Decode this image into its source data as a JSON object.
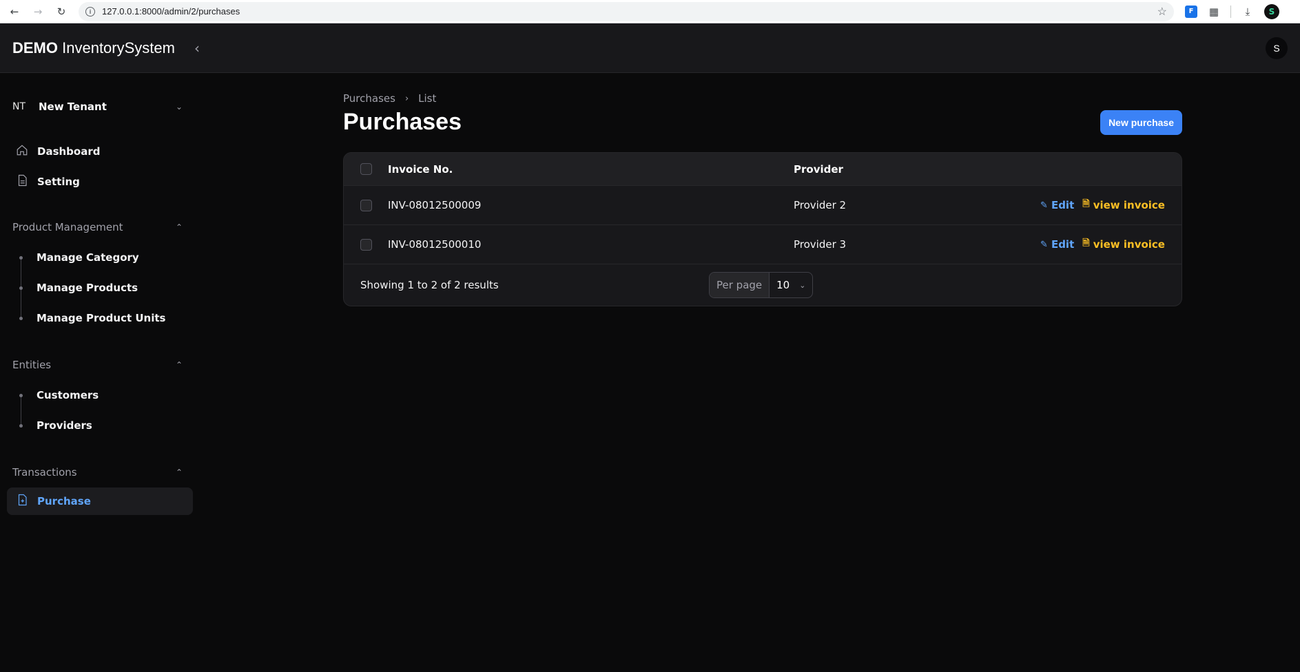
{
  "browser": {
    "url": "127.0.0.1:8000/admin/2/purchases",
    "ext_label": "F",
    "profile_initial": "S"
  },
  "topbar": {
    "brand_bold": "DEMO",
    "brand_rest": "InventorySystem",
    "avatar_initial": "S"
  },
  "tenant": {
    "initials": "NT",
    "name": "New Tenant"
  },
  "sidebar": {
    "top_items": [
      {
        "label": "Dashboard",
        "icon": "home-icon"
      },
      {
        "label": "Setting",
        "icon": "document-icon"
      }
    ],
    "groups": [
      {
        "title": "Product Management",
        "items": [
          "Manage Category",
          "Manage Products",
          "Manage Product Units"
        ]
      },
      {
        "title": "Entities",
        "items": [
          "Customers",
          "Providers"
        ]
      },
      {
        "title": "Transactions",
        "active_item": {
          "label": "Purchase",
          "icon": "document-plus-icon"
        }
      }
    ]
  },
  "breadcrumb": {
    "first": "Purchases",
    "second": "List"
  },
  "page": {
    "title": "Purchases",
    "new_button": "New purchase"
  },
  "table": {
    "headers": {
      "invoice": "Invoice No.",
      "provider": "Provider"
    },
    "rows": [
      {
        "invoice": "INV-08012500009",
        "provider": "Provider 2",
        "edit": "Edit",
        "view": "view invoice"
      },
      {
        "invoice": "INV-08012500010",
        "provider": "Provider 3",
        "edit": "Edit",
        "view": "view invoice"
      }
    ],
    "footer_text": "Showing 1 to 2 of 2 results",
    "per_page_label": "Per page",
    "per_page_value": "10"
  },
  "colors": {
    "accent": "#3b82f6",
    "link_blue": "#60a5fa",
    "link_amber": "#fbbf24",
    "background": "#0a0a0b"
  }
}
